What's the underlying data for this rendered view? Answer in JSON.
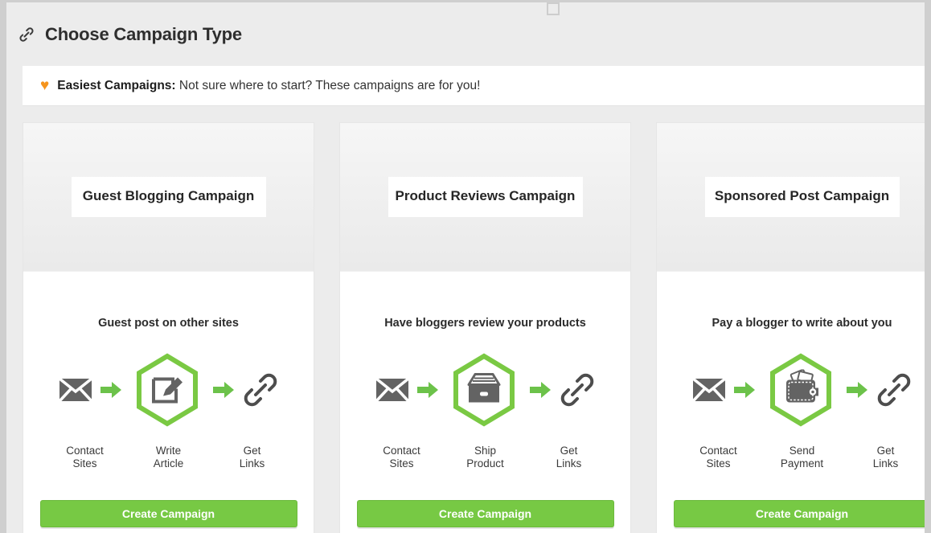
{
  "header": {
    "icon": "link-chain-icon",
    "title": "Choose Campaign Type"
  },
  "notice": {
    "icon": "heart-icon",
    "strong_label": "Easiest Campaigns:",
    "message": " Not sure where to start? These campaigns are for you!"
  },
  "colors": {
    "accent_green": "#77c944",
    "heart_orange": "#f5941e",
    "icon_gray": "#636363",
    "panel_bg": "#ececec",
    "card_bg": "#ffffff"
  },
  "cards": [
    {
      "title": "Guest Blogging Campaign",
      "subtitle": "Guest post on other sites",
      "center_icon": "write-article-icon",
      "steps": [
        {
          "icon": "envelope-icon",
          "label_line1": "Contact",
          "label_line2": "Sites"
        },
        {
          "icon": "pencil-square-icon",
          "label_line1": "Write",
          "label_line2": "Article"
        },
        {
          "icon": "link-chain-icon",
          "label_line1": "Get",
          "label_line2": "Links"
        }
      ],
      "cta_label": "Create Campaign"
    },
    {
      "title": "Product Reviews Campaign",
      "subtitle": "Have bloggers review your products",
      "center_icon": "shipping-box-icon",
      "steps": [
        {
          "icon": "envelope-icon",
          "label_line1": "Contact",
          "label_line2": "Sites"
        },
        {
          "icon": "shipping-box-icon",
          "label_line1": "Ship",
          "label_line2": "Product"
        },
        {
          "icon": "link-chain-icon",
          "label_line1": "Get",
          "label_line2": "Links"
        }
      ],
      "cta_label": "Create Campaign"
    },
    {
      "title": "Sponsored Post Campaign",
      "subtitle": "Pay a blogger to write about you",
      "center_icon": "wallet-icon",
      "steps": [
        {
          "icon": "envelope-icon",
          "label_line1": "Contact",
          "label_line2": "Sites"
        },
        {
          "icon": "wallet-icon",
          "label_line1": "Send",
          "label_line2": "Payment"
        },
        {
          "icon": "link-chain-icon",
          "label_line1": "Get",
          "label_line2": "Links"
        }
      ],
      "cta_label": "Create Campaign"
    }
  ]
}
